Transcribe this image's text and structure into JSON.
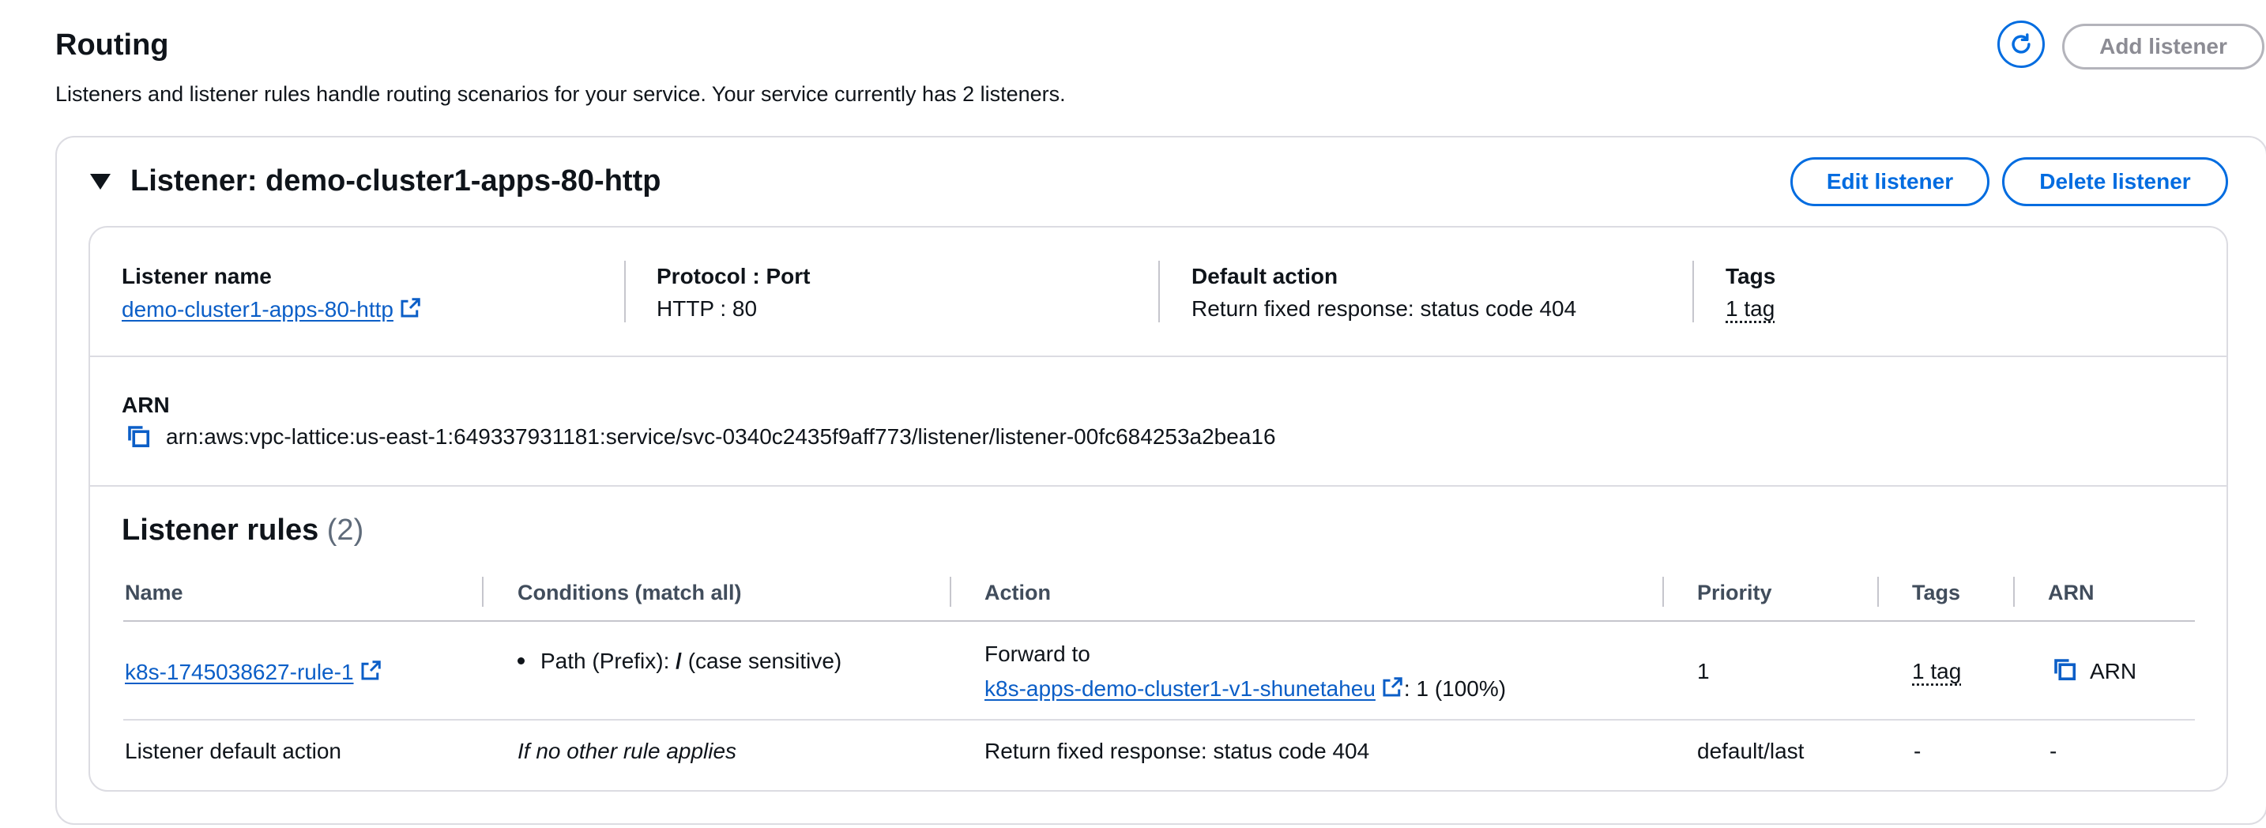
{
  "header": {
    "title": "Routing",
    "description": "Listeners and listener rules handle routing scenarios for your service. Your service currently has 2 listeners.",
    "add_listener_label": "Add listener",
    "refresh_icon": "refresh-icon"
  },
  "listener": {
    "heading": "Listener: demo-cluster1-apps-80-http",
    "edit_label": "Edit listener",
    "delete_label": "Delete listener",
    "details": {
      "name_label": "Listener name",
      "name_value": "demo-cluster1-apps-80-http",
      "protocol_label": "Protocol : Port",
      "protocol_value": "HTTP : 80",
      "default_action_label": "Default action",
      "default_action_value": "Return fixed response: status code 404",
      "tags_label": "Tags",
      "tags_value": "1 tag"
    },
    "arn": {
      "label": "ARN",
      "value": "arn:aws:vpc-lattice:us-east-1:649337931181:service/svc-0340c2435f9aff773/listener/listener-00fc684253a2bea16"
    },
    "rules": {
      "title": "Listener rules",
      "count": "(2)",
      "columns": [
        "Name",
        "Conditions (match all)",
        "Action",
        "Priority",
        "Tags",
        "ARN"
      ],
      "rows": [
        {
          "name": "k8s-1745038627-rule-1",
          "condition_prefix": "Path (Prefix): ",
          "condition_path": "/",
          "condition_suffix": " (case sensitive)",
          "action_line1": "Forward to",
          "action_target": "k8s-apps-demo-cluster1-v1-shunetaheu",
          "action_weight": ": 1 (100%)",
          "priority": "1",
          "tags": "1 tag",
          "arn": "ARN"
        },
        {
          "name": "Listener default action",
          "condition": "If no other rule applies",
          "action": "Return fixed response: status code 404",
          "priority": "default/last",
          "tags": "-",
          "arn": "-"
        }
      ]
    }
  },
  "colors": {
    "accent": "#006ce0",
    "link": "#0b5ec7",
    "disabled": "#8c8c94",
    "border": "#dcdce2"
  }
}
